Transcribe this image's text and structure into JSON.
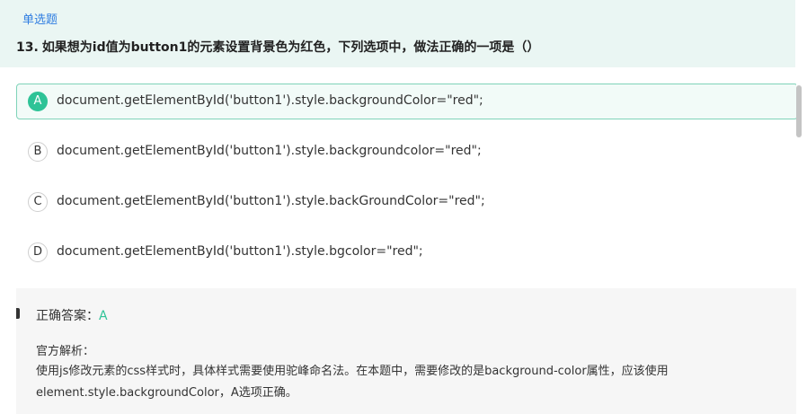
{
  "question": {
    "type_label": "单选题",
    "number": "13.",
    "stem": "如果想为id值为button1的元素设置背景色为红色，下列选项中，做法正确的一项是（）"
  },
  "options": [
    {
      "letter": "A",
      "text": "document.getElementById('button1').style.backgroundColor=\"red\";",
      "selected": true
    },
    {
      "letter": "B",
      "text": "document.getElementById('button1').style.backgroundcolor=\"red\";",
      "selected": false
    },
    {
      "letter": "C",
      "text": "document.getElementById('button1').style.backGroundColor=\"red\";",
      "selected": false
    },
    {
      "letter": "D",
      "text": "document.getElementById('button1').style.bgcolor=\"red\";",
      "selected": false
    }
  ],
  "answer": {
    "label": "正确答案：",
    "value": "A",
    "analysis_title": "官方解析：",
    "analysis_line1": "使用js修改元素的css样式时，具体样式需要使用驼峰命名法。在本题中，需要修改的是background-color属性，应该使用",
    "analysis_line2": "element.style.backgroundColor，A选项正确。"
  },
  "colors": {
    "accent": "#2ec397",
    "header_bg": "#eaf6f3",
    "type_label": "#2f7de1"
  }
}
